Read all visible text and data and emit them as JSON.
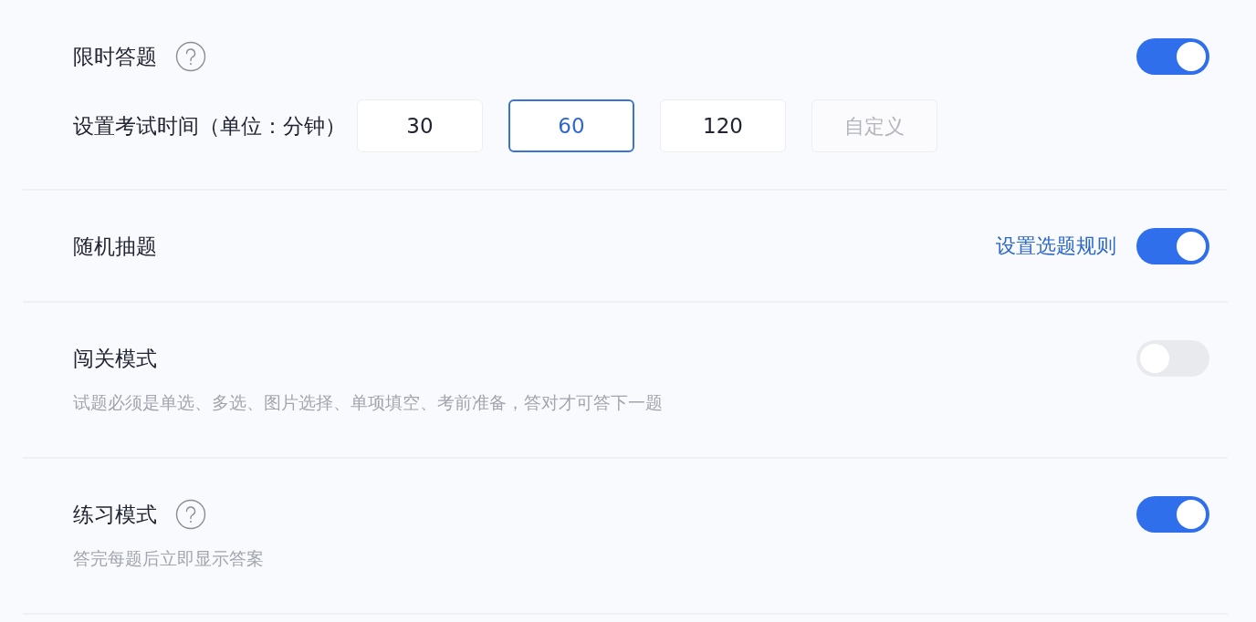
{
  "settings": [
    {
      "kind": "timer",
      "title": "限时答题",
      "help": true,
      "on": true,
      "time_label": "设置考试时间（单位：分钟）",
      "options": [
        {
          "label": "30",
          "selected": false
        },
        {
          "label": "60",
          "selected": true
        },
        {
          "label": "120",
          "selected": false
        }
      ],
      "custom": {
        "placeholder": "自定义"
      }
    },
    {
      "kind": "plain",
      "title": "随机抽题",
      "help": false,
      "on": true,
      "link": "设置选题规则"
    },
    {
      "kind": "plain",
      "title": "闯关模式",
      "help": false,
      "on": false,
      "description": "试题必须是单选、多选、图片选择、单项填空、考前准备，答对才可答下一题"
    },
    {
      "kind": "plain",
      "title": "练习模式",
      "help": true,
      "on": true,
      "description": "答完每题后立即显示答案"
    }
  ]
}
